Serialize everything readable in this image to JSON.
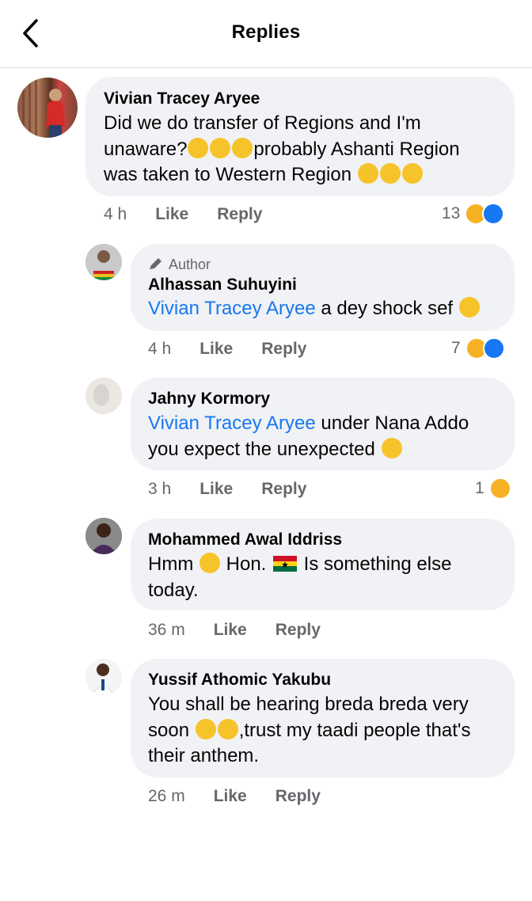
{
  "header": {
    "title": "Replies"
  },
  "comments": [
    {
      "name": "Vivian Tracey Aryee",
      "lines": [
        "Did we do transfer of Regions and I'm",
        "unaware?",
        "probably Ashanti Region",
        "was taken to Western Region "
      ],
      "time": "4 h",
      "like": "Like",
      "reply": "Reply",
      "reactions": "13"
    },
    {
      "author_label": "Author",
      "name": "Alhassan Suhuyini",
      "mention": "Vivian Tracey Aryee",
      "text": " a dey shock sef ",
      "time": "4 h",
      "like": "Like",
      "reply": "Reply",
      "reactions": "7"
    },
    {
      "name": "Jahny Kormory",
      "mention": "Vivian Tracey Aryee",
      "text": " under Nana Addo",
      "line2": "you expect the unexpected ",
      "time": "3 h",
      "like": "Like",
      "reply": "Reply",
      "reactions": "1"
    },
    {
      "name": "Mohammed Awal Iddriss",
      "line1a": "Hmm ",
      "line1b": " Hon. ",
      "line1c": " Is something else",
      "line2": "today.",
      "time": "36 m",
      "like": "Like",
      "reply": "Reply"
    },
    {
      "name": "Yussif Athomic Yakubu",
      "line1": "You shall be hearing breda breda very",
      "line2a": "soon ",
      "line2b": ",trust my taadi people that's",
      "line3": "their anthem.",
      "time": "26 m",
      "like": "Like",
      "reply": "Reply"
    }
  ]
}
